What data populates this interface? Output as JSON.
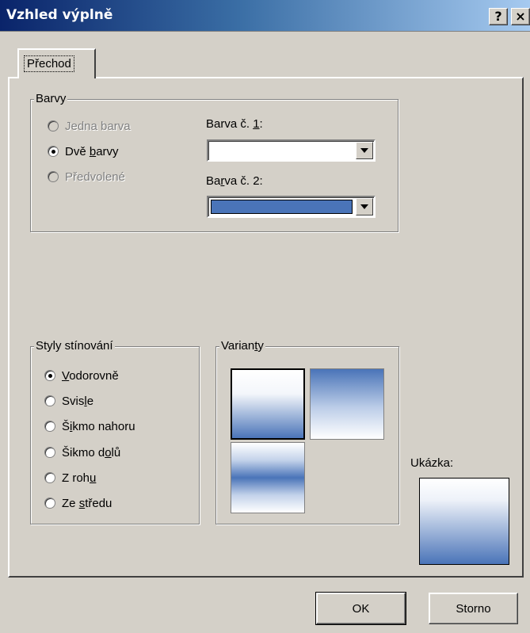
{
  "window": {
    "title": "Vzhled výplně",
    "help_label": "?",
    "close_label": "×"
  },
  "tab": {
    "label": "Přechod"
  },
  "colors_group": {
    "legend": "Barvy",
    "options": [
      {
        "label_pre": "Jedna barva",
        "label_u": "",
        "label_post": "",
        "checked": false,
        "enabled": false
      },
      {
        "label_pre": "Dvě ",
        "label_u": "b",
        "label_post": "arvy",
        "checked": true,
        "enabled": true
      },
      {
        "label_pre": "Předvolené",
        "label_u": "",
        "label_post": "",
        "checked": false,
        "enabled": false
      }
    ],
    "color1": {
      "label_pre": "Barva č. ",
      "label_u": "1",
      "label_post": ":",
      "value_color": "#ffffff"
    },
    "color2": {
      "label_pre": "Ba",
      "label_u": "r",
      "label_post": "va č. 2:",
      "value_color": "#4a74b8"
    }
  },
  "shading_group": {
    "legend": "Styly stínování",
    "options": [
      {
        "label_pre": "",
        "label_u": "V",
        "label_post": "odorovně",
        "checked": true
      },
      {
        "label_pre": "Svis",
        "label_u": "l",
        "label_post": "e",
        "checked": false
      },
      {
        "label_pre": "Š",
        "label_u": "i",
        "label_post": "kmo nahoru",
        "checked": false
      },
      {
        "label_pre": "Šikmo d",
        "label_u": "o",
        "label_post": "lů",
        "checked": false
      },
      {
        "label_pre": "Z roh",
        "label_u": "u",
        "label_post": "",
        "checked": false
      },
      {
        "label_pre": "Ze ",
        "label_u": "s",
        "label_post": "tředu",
        "checked": false
      }
    ]
  },
  "variants_group": {
    "legend_pre": "Varian",
    "legend_u": "t",
    "legend_post": "y"
  },
  "preview": {
    "label": "Ukázka:"
  },
  "buttons": {
    "ok": "OK",
    "cancel": "Storno"
  },
  "accent_colors": {
    "gradient_blue": "#4a74b8",
    "title_bar": "#0a246a"
  }
}
